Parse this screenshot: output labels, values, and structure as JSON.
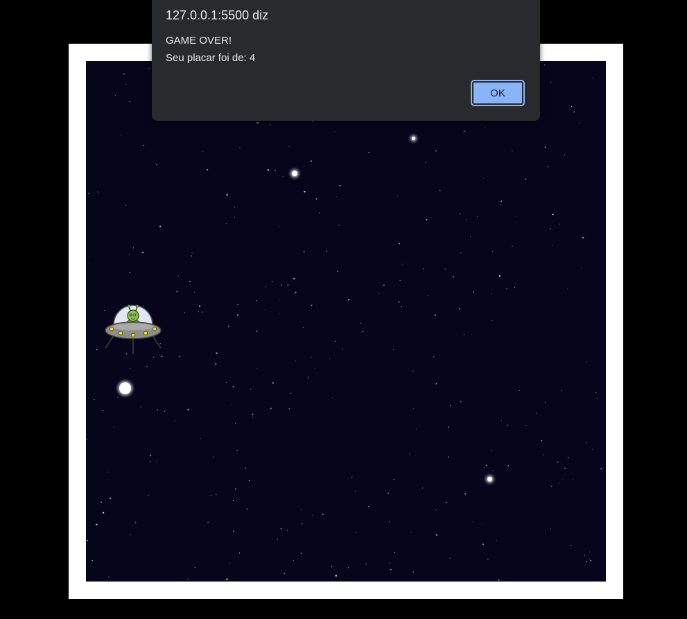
{
  "dialog": {
    "title": "127.0.0.1:5500 diz",
    "message_line1": "GAME OVER!",
    "message_line2": "Seu placar foi de: 4",
    "ok_label": "OK"
  },
  "game": {
    "background_color": "#06051c",
    "frame_color": "#ffffff",
    "player_icon": "alien-ufo-icon",
    "obstacle_icon": "glowing-star-icon"
  }
}
